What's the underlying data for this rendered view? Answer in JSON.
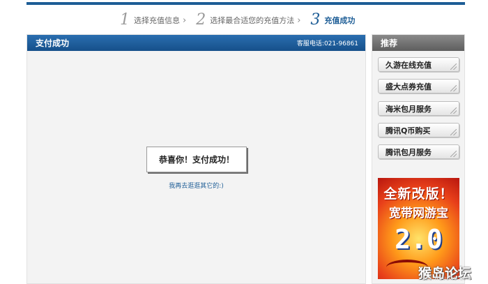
{
  "steps": [
    {
      "num": "1",
      "label": "选择充值信息"
    },
    {
      "num": "2",
      "label": "选择最合适您的充值方法"
    },
    {
      "num": "3",
      "label": "充值成功"
    }
  ],
  "step_arrow": "›",
  "main": {
    "title": "支付成功",
    "hotline": "客服电话:021-96861",
    "success_message": "恭喜你！支付成功！",
    "browse_link": "我再去逛逛其它的:)"
  },
  "sidebar": {
    "title": "推荐",
    "items": [
      {
        "label": "久游在线充值"
      },
      {
        "label": "盛大点券充值"
      },
      {
        "label": "海米包月服务"
      },
      {
        "label": "腾讯Q币购买"
      },
      {
        "label": "腾讯包月服务"
      }
    ],
    "promo": {
      "line1": "全新改版！",
      "line2": "宽带网游宝",
      "version": "2.0"
    }
  },
  "watermark": {
    "text": "猴岛论坛",
    "url": "BBS.HOUDAO.COM"
  },
  "colors": {
    "accent_blue": "#1d5d96",
    "header_gray": "#6e6e6e",
    "panel_bg": "#f3f3f3"
  }
}
